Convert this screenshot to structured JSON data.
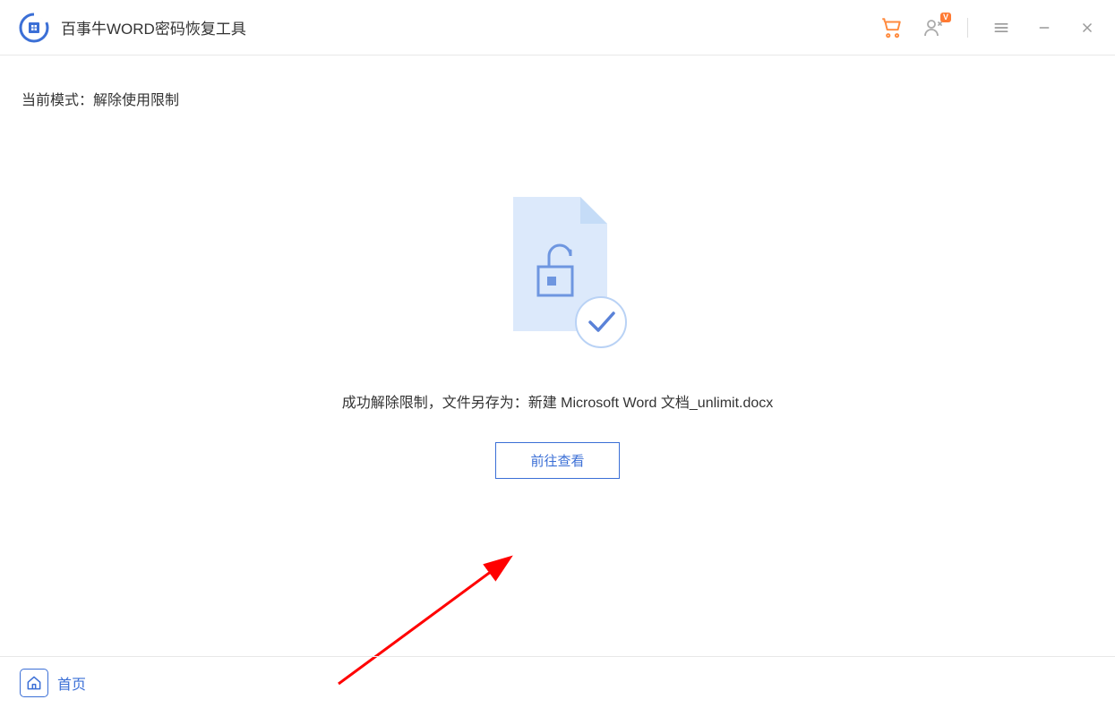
{
  "header": {
    "app_title": "百事牛WORD密码恢复工具",
    "user_badge": "V"
  },
  "content": {
    "mode_label_prefix": "当前模式：",
    "mode_value": "解除使用限制",
    "success_prefix": "成功解除限制，文件另存为：",
    "saved_filename": "新建 Microsoft Word 文档_unlimit.docx",
    "view_button_label": "前往查看"
  },
  "footer": {
    "home_label": "首页"
  },
  "colors": {
    "accent": "#3b6fd6",
    "cart": "#ff8a3d",
    "badge": "#ff7a33",
    "arrow": "#ff0000"
  }
}
